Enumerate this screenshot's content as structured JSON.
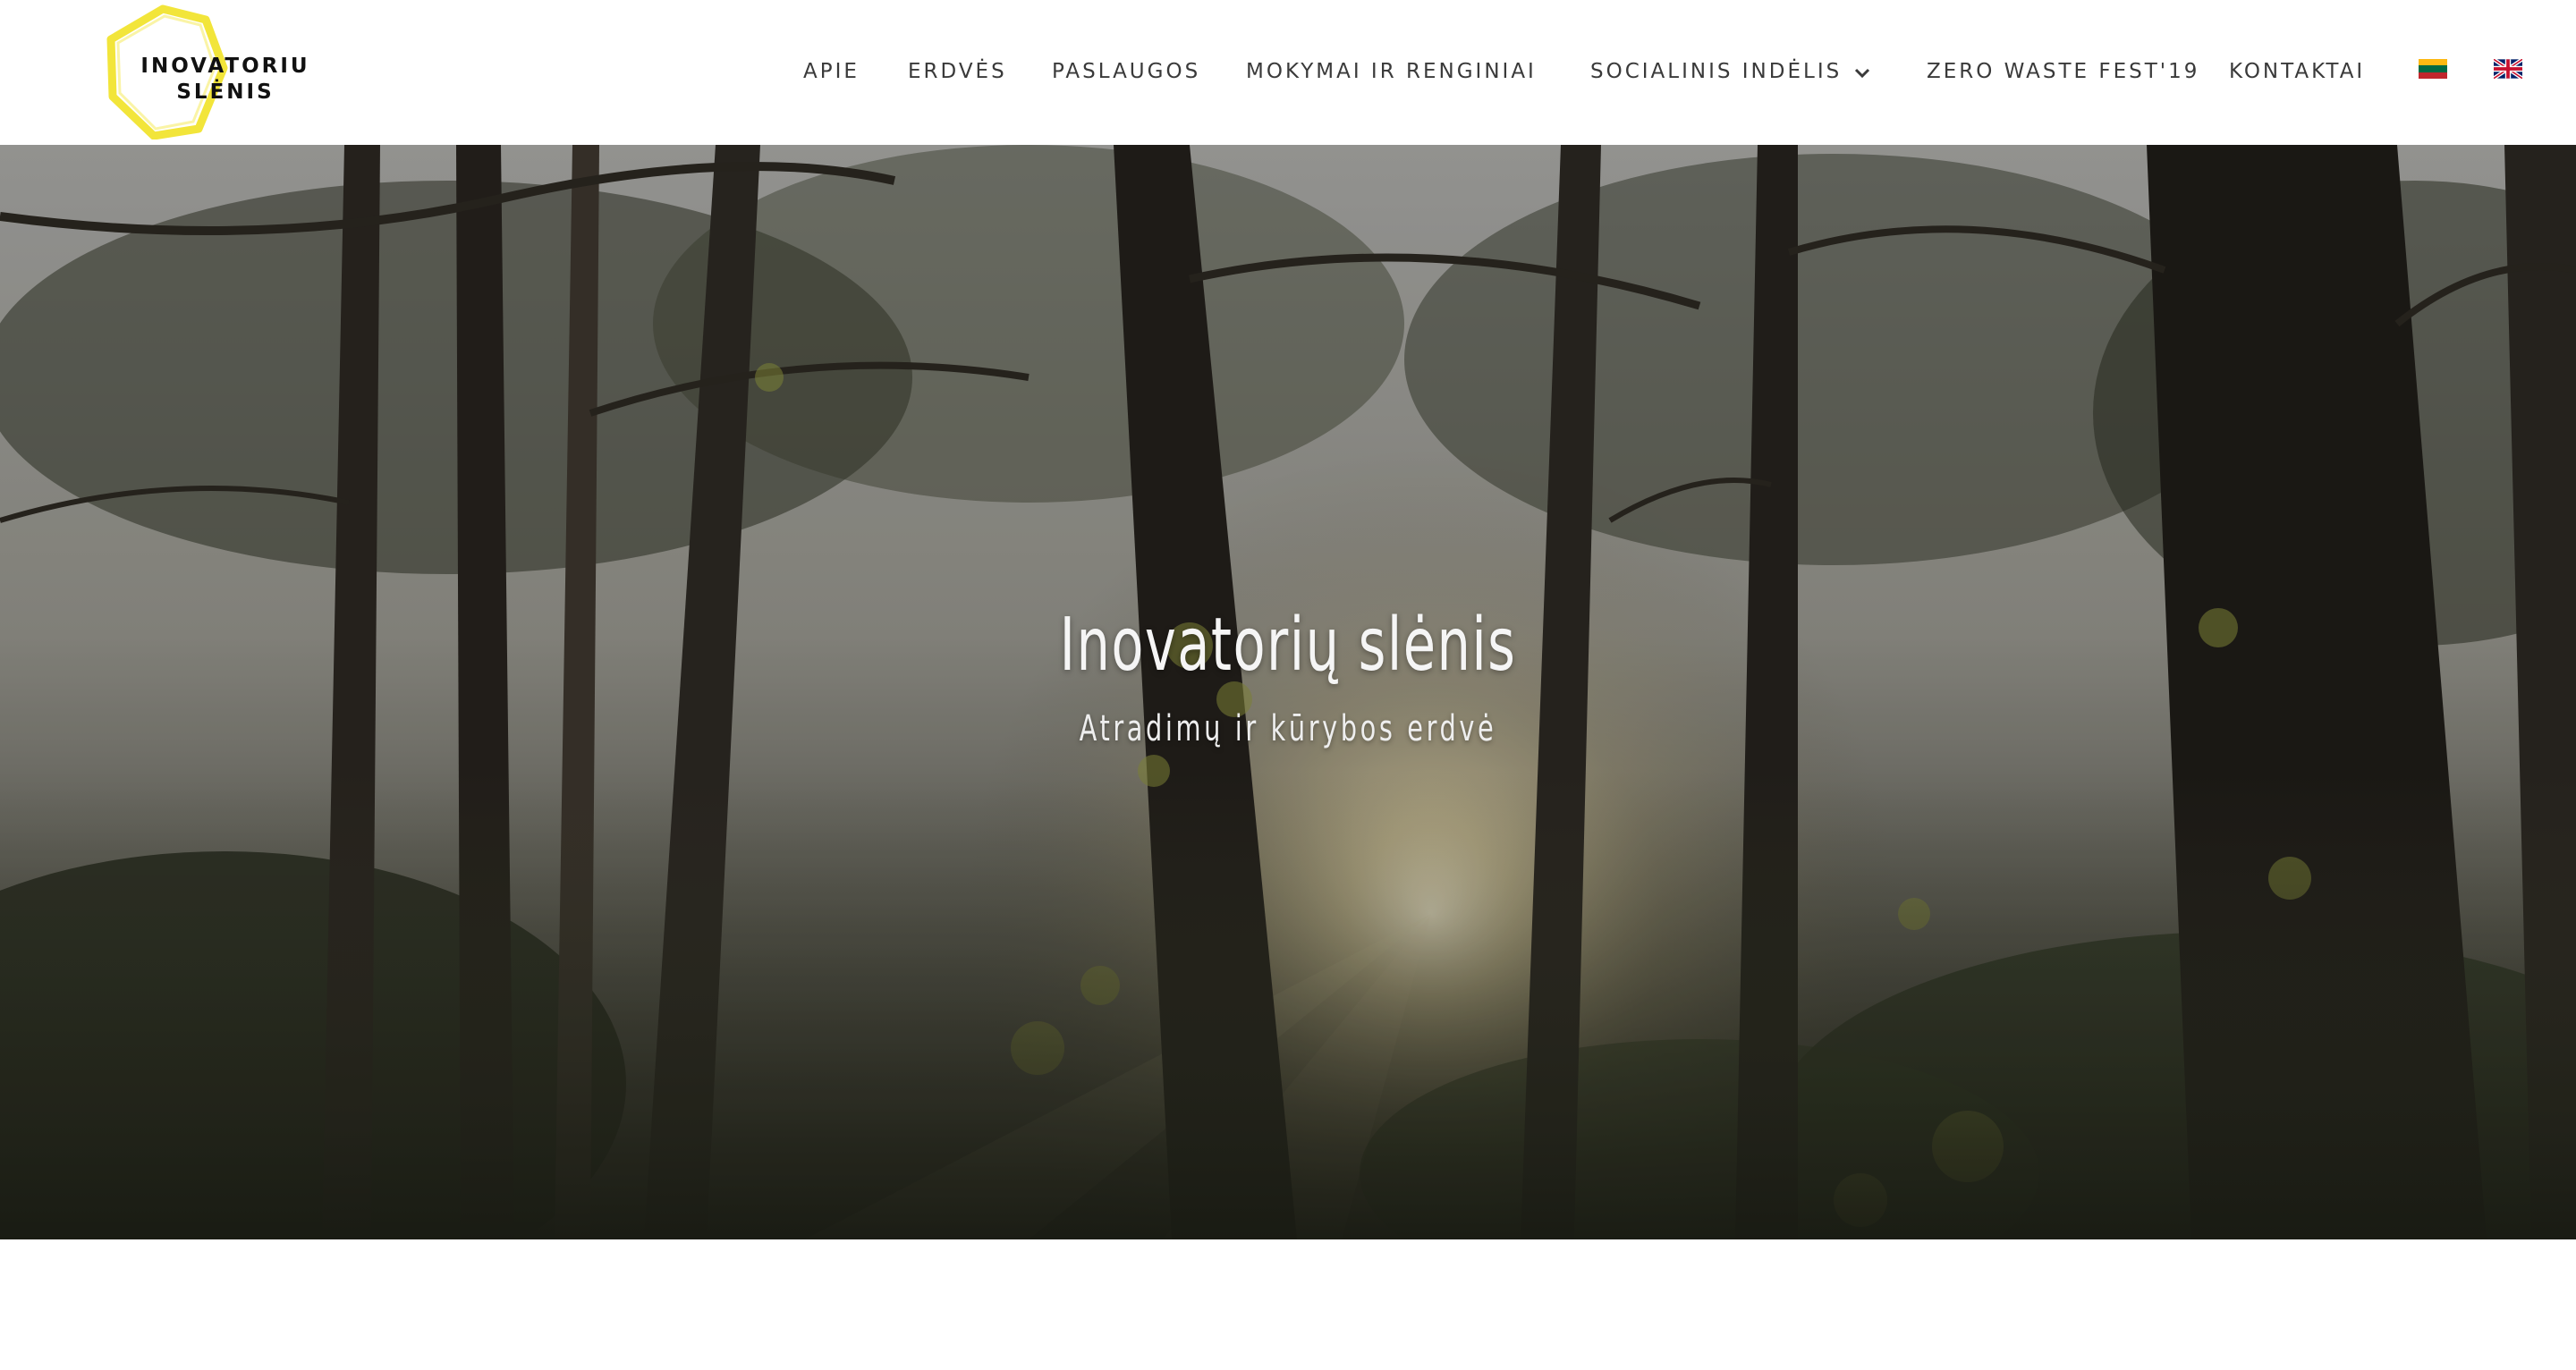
{
  "header": {
    "logo": {
      "line1": "INOVATORIU",
      "line2": "SLĖNIS"
    },
    "nav": [
      {
        "label": "APIE"
      },
      {
        "label": "ERDVĖS"
      },
      {
        "label": "PASLAUGOS"
      },
      {
        "label": "MOKYMAI IR RENGINIAI"
      },
      {
        "label": "SOCIALINIS INDĖLIS",
        "has_dropdown": true
      },
      {
        "label": "ZERO WASTE FEST'19"
      },
      {
        "label": "KONTAKTAI"
      }
    ],
    "languages": [
      {
        "flag": "lithuania-flag-icon"
      },
      {
        "flag": "uk-flag-icon"
      }
    ]
  },
  "hero": {
    "title": "Inovatorių slėnis",
    "subtitle": "Atradimų ir kūrybos erdvė"
  },
  "colors": {
    "logo_yellow": "#f2e53a",
    "nav_text": "#3a3a3a",
    "hero_text": "#f5f5f5"
  }
}
